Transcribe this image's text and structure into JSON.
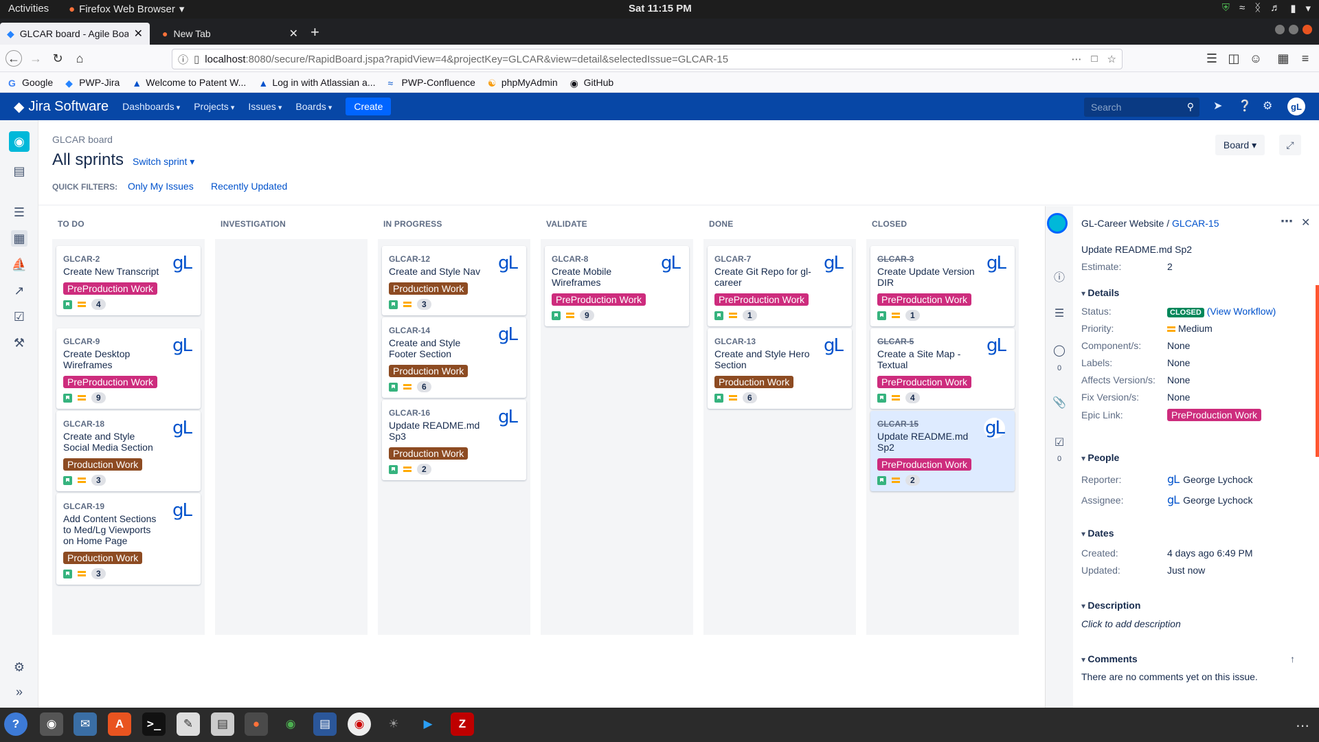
{
  "os": {
    "activities": "Activities",
    "app_name": "Firefox Web Browser",
    "clock": "Sat 11:15 PM"
  },
  "browser": {
    "tabs": [
      {
        "title": "GLCAR board - Agile Boa"
      },
      {
        "title": "New Tab"
      }
    ],
    "url_host": "localhost",
    "url_path": ":8080/secure/RapidBoard.jspa?rapidView=4&projectKey=GLCAR&view=detail&selectedIssue=GLCAR-15",
    "bookmarks": [
      "Google",
      "PWP-Jira",
      "Welcome to Patent W...",
      "Log in with Atlassian a...",
      "PWP-Confluence",
      "phpMyAdmin",
      "GitHub"
    ]
  },
  "jira": {
    "product": "Jira Software",
    "nav": [
      "Dashboards",
      "Projects",
      "Issues",
      "Boards"
    ],
    "create": "Create",
    "search_placeholder": "Search",
    "user_initials": "gL"
  },
  "board": {
    "breadcrumb": "GLCAR board",
    "title": "All sprints",
    "switch_sprint": "Switch sprint",
    "quick_filters_label": "QUICK FILTERS:",
    "quick_filters": [
      "Only My Issues",
      "Recently Updated"
    ],
    "view_button": "Board",
    "columns": [
      {
        "title": "TO DO",
        "cards": [
          {
            "key": "GLCAR-2",
            "summary": "Create New Transcript",
            "epic": "PreProduction Work",
            "epic_color": "#cd2c7d",
            "estimate": "4",
            "done": false
          },
          {
            "key": "GLCAR-9",
            "summary": "Create Desktop Wireframes",
            "epic": "PreProduction Work",
            "epic_color": "#cd2c7d",
            "estimate": "9",
            "done": false
          },
          {
            "key": "GLCAR-18",
            "summary": "Create and Style Social Media Section",
            "epic": "Production Work",
            "epic_color": "#8d4b22",
            "estimate": "3",
            "done": false
          },
          {
            "key": "GLCAR-19",
            "summary": "Add Content Sections to Med/Lg Viewports on Home Page",
            "epic": "Production Work",
            "epic_color": "#8d4b22",
            "estimate": "3",
            "done": false
          }
        ]
      },
      {
        "title": "INVESTIGATION",
        "cards": []
      },
      {
        "title": "IN PROGRESS",
        "cards": [
          {
            "key": "GLCAR-12",
            "summary": "Create and Style Nav",
            "epic": "Production Work",
            "epic_color": "#8d4b22",
            "estimate": "3",
            "done": false
          },
          {
            "key": "GLCAR-14",
            "summary": "Create and Style Footer Section",
            "epic": "Production Work",
            "epic_color": "#8d4b22",
            "estimate": "6",
            "done": false
          },
          {
            "key": "GLCAR-16",
            "summary": "Update README.md Sp3",
            "epic": "Production Work",
            "epic_color": "#8d4b22",
            "estimate": "2",
            "done": false
          }
        ]
      },
      {
        "title": "VALIDATE",
        "cards": [
          {
            "key": "GLCAR-8",
            "summary": "Create Mobile Wireframes",
            "epic": "PreProduction Work",
            "epic_color": "#cd2c7d",
            "estimate": "9",
            "done": false
          }
        ]
      },
      {
        "title": "DONE",
        "cards": [
          {
            "key": "GLCAR-7",
            "summary": "Create Git Repo for gl-career",
            "epic": "PreProduction Work",
            "epic_color": "#cd2c7d",
            "estimate": "1",
            "done": false
          },
          {
            "key": "GLCAR-13",
            "summary": "Create and Style Hero Section",
            "epic": "Production Work",
            "epic_color": "#8d4b22",
            "estimate": "6",
            "done": false
          }
        ]
      },
      {
        "title": "CLOSED",
        "cards": [
          {
            "key": "GLCAR-3",
            "summary": "Create Update Version DIR",
            "epic": "PreProduction Work",
            "epic_color": "#cd2c7d",
            "estimate": "1",
            "done": true
          },
          {
            "key": "GLCAR-5",
            "summary": "Create a Site Map - Textual",
            "epic": "PreProduction Work",
            "epic_color": "#cd2c7d",
            "estimate": "4",
            "done": true
          },
          {
            "key": "GLCAR-15",
            "summary": "Update README.md Sp2",
            "epic": "PreProduction Work",
            "epic_color": "#cd2c7d",
            "estimate": "2",
            "done": true,
            "selected": true
          }
        ]
      }
    ]
  },
  "detail": {
    "project": "GL-Career Website",
    "separator": " / ",
    "issue_key": "GLCAR-15",
    "summary": "Update README.md Sp2",
    "estimate_label": "Estimate:",
    "estimate": "2",
    "sections": {
      "details": "Details",
      "people": "People",
      "dates": "Dates",
      "description": "Description",
      "comments": "Comments"
    },
    "status_label": "Status:",
    "status": "CLOSED",
    "view_workflow": "(View Workflow)",
    "priority_label": "Priority:",
    "priority": "Medium",
    "components_label": "Component/s:",
    "components": "None",
    "labels_label": "Labels:",
    "labels": "None",
    "affects_label": "Affects Version/s:",
    "affects": "None",
    "fix_label": "Fix Version/s:",
    "fix": "None",
    "epic_label": "Epic Link:",
    "epic": "PreProduction Work",
    "reporter_label": "Reporter:",
    "reporter": "George Lychock",
    "assignee_label": "Assignee:",
    "assignee": "George Lychock",
    "created_label": "Created:",
    "created": "4 days ago 6:49 PM",
    "updated_label": "Updated:",
    "updated": "Just now",
    "description_placeholder": "Click to add description",
    "comments_empty": "There are no comments yet on this issue.",
    "comment_count": "0",
    "attachment_count": "0"
  }
}
